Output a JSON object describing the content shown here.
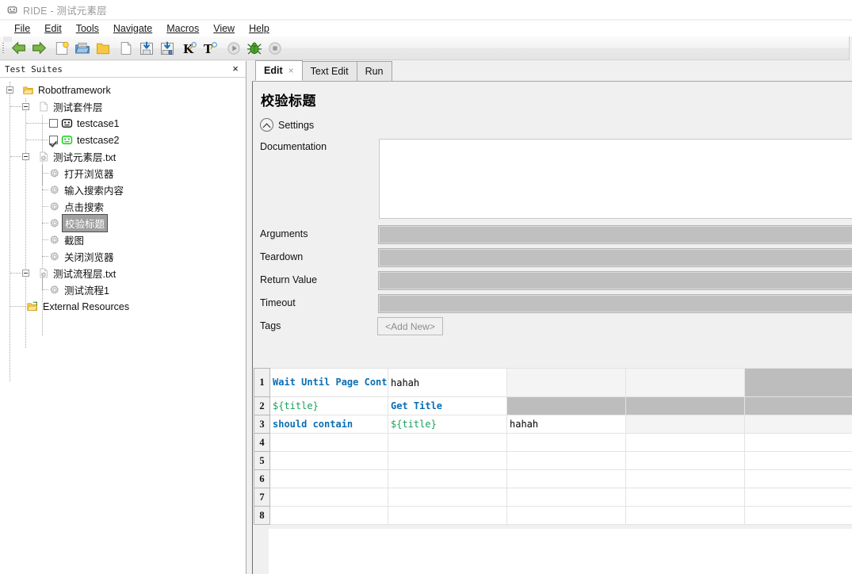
{
  "window": {
    "title": "RIDE - 测试元素层",
    "icon": "robot-icon"
  },
  "menubar": {
    "items": [
      {
        "label": "File",
        "mnemonic": "F"
      },
      {
        "label": "Edit",
        "mnemonic": "E"
      },
      {
        "label": "Tools",
        "mnemonic": "T"
      },
      {
        "label": "Navigate",
        "mnemonic": "N"
      },
      {
        "label": "Macros",
        "mnemonic": "M"
      },
      {
        "label": "View",
        "mnemonic": "V"
      },
      {
        "label": "Help",
        "mnemonic": "H"
      }
    ]
  },
  "toolbar": {
    "buttons": [
      {
        "name": "back-icon",
        "tip": "Back"
      },
      {
        "name": "forward-icon",
        "tip": "Forward"
      },
      {
        "name": "new-project-icon",
        "tip": "New Project"
      },
      {
        "name": "open-project-icon",
        "tip": "Open Project"
      },
      {
        "name": "open-directory-icon",
        "tip": "Open Directory"
      },
      {
        "name": "new-file-icon",
        "tip": "New File"
      },
      {
        "name": "save-icon",
        "tip": "Save"
      },
      {
        "name": "save-all-icon",
        "tip": "Save All"
      },
      {
        "name": "search-keyword-icon",
        "tip": "Search Keywords"
      },
      {
        "name": "search-tests-icon",
        "tip": "Search Tests"
      },
      {
        "name": "run-icon",
        "tip": "Run"
      },
      {
        "name": "debug-icon",
        "tip": "Debug"
      },
      {
        "name": "stop-icon",
        "tip": "Stop"
      }
    ]
  },
  "sidebar": {
    "title": "Test Suites",
    "close_label": "×",
    "tree": [
      {
        "label": "Robotframework",
        "icon": "folder-icon",
        "depth": 0,
        "expander": true,
        "checkbox": null
      },
      {
        "label": "测试套件层",
        "icon": "file-icon",
        "depth": 1,
        "expander": true,
        "checkbox": null
      },
      {
        "label": "testcase1",
        "icon": "robot-black-icon",
        "depth": 2,
        "expander": false,
        "checkbox": "unchecked"
      },
      {
        "label": "testcase2",
        "icon": "robot-green-icon",
        "depth": 2,
        "expander": false,
        "checkbox": "checked"
      },
      {
        "label": "测试元素层.txt",
        "icon": "resource-file-icon",
        "depth": 1,
        "expander": true,
        "checkbox": null
      },
      {
        "label": "打开浏览器",
        "icon": "gear-icon",
        "depth": 2,
        "expander": false,
        "checkbox": null
      },
      {
        "label": "输入搜索内容",
        "icon": "gear-icon",
        "depth": 2,
        "expander": false,
        "checkbox": null
      },
      {
        "label": "点击搜索",
        "icon": "gear-icon",
        "depth": 2,
        "expander": false,
        "checkbox": null
      },
      {
        "label": "校验标题",
        "icon": "gear-icon",
        "depth": 2,
        "expander": false,
        "checkbox": null,
        "selected": true
      },
      {
        "label": "截图",
        "icon": "gear-icon",
        "depth": 2,
        "expander": false,
        "checkbox": null
      },
      {
        "label": "关闭浏览器",
        "icon": "gear-icon",
        "depth": 2,
        "expander": false,
        "checkbox": null
      },
      {
        "label": "测试流程层.txt",
        "icon": "resource-file-icon",
        "depth": 1,
        "expander": true,
        "checkbox": null
      },
      {
        "label": "测试流程1",
        "icon": "gear-icon",
        "depth": 2,
        "expander": false,
        "checkbox": null
      },
      {
        "label": "External Resources",
        "icon": "ext-resources-icon",
        "depth": 1,
        "expander": false,
        "checkbox": null
      }
    ]
  },
  "editor": {
    "tabs": [
      {
        "label": "Edit",
        "active": true,
        "closable": true,
        "close_label": "×"
      },
      {
        "label": "Text Edit",
        "active": false,
        "closable": false
      },
      {
        "label": "Run",
        "active": false,
        "closable": false
      }
    ],
    "keyword_title": "校验标题",
    "settings_label": "Settings",
    "fields": [
      {
        "label": "Documentation",
        "value": "",
        "kind": "textarea"
      },
      {
        "label": "Arguments",
        "value": "",
        "kind": "text"
      },
      {
        "label": "Teardown",
        "value": "",
        "kind": "text"
      },
      {
        "label": "Return Value",
        "value": "",
        "kind": "text"
      },
      {
        "label": "Timeout",
        "value": "",
        "kind": "text"
      },
      {
        "label": "Tags",
        "value": "<Add New>",
        "kind": "button"
      }
    ],
    "grid": {
      "row_numbers": [
        "1",
        "2",
        "3",
        "4",
        "5",
        "6",
        "7",
        "8"
      ],
      "rows": [
        {
          "num": "1",
          "cells": [
            {
              "text": "Wait Until Page Contains",
              "style": "kw",
              "bg": "white"
            },
            {
              "text": "hahah",
              "style": "txt",
              "bg": "white"
            },
            {
              "text": "",
              "style": "none",
              "bg": "lite"
            },
            {
              "text": "",
              "style": "none",
              "bg": "lite"
            },
            {
              "text": "",
              "style": "none",
              "bg": "gray"
            }
          ]
        },
        {
          "num": "2",
          "cells": [
            {
              "text": "${title}",
              "style": "var",
              "bg": "white"
            },
            {
              "text": "Get Title",
              "style": "kw",
              "bg": "white"
            },
            {
              "text": "",
              "style": "none",
              "bg": "gray"
            },
            {
              "text": "",
              "style": "none",
              "bg": "gray"
            },
            {
              "text": "",
              "style": "none",
              "bg": "gray"
            }
          ]
        },
        {
          "num": "3",
          "cells": [
            {
              "text": "should contain",
              "style": "kw",
              "bg": "white"
            },
            {
              "text": "${title}",
              "style": "var",
              "bg": "white"
            },
            {
              "text": "hahah",
              "style": "txt",
              "bg": "white"
            },
            {
              "text": "",
              "style": "none",
              "bg": "lite"
            },
            {
              "text": "",
              "style": "none",
              "bg": "lite"
            }
          ]
        },
        {
          "num": "4",
          "cells": [
            {
              "text": "",
              "style": "none",
              "bg": "white"
            },
            {
              "text": "",
              "style": "none",
              "bg": "white"
            },
            {
              "text": "",
              "style": "none",
              "bg": "white"
            },
            {
              "text": "",
              "style": "none",
              "bg": "white"
            },
            {
              "text": "",
              "style": "none",
              "bg": "white"
            }
          ]
        },
        {
          "num": "5",
          "cells": [
            {
              "text": "",
              "style": "none",
              "bg": "white"
            },
            {
              "text": "",
              "style": "none",
              "bg": "white"
            },
            {
              "text": "",
              "style": "none",
              "bg": "white"
            },
            {
              "text": "",
              "style": "none",
              "bg": "white"
            },
            {
              "text": "",
              "style": "none",
              "bg": "white"
            }
          ]
        },
        {
          "num": "6",
          "cells": [
            {
              "text": "",
              "style": "none",
              "bg": "white"
            },
            {
              "text": "",
              "style": "none",
              "bg": "white"
            },
            {
              "text": "",
              "style": "none",
              "bg": "white"
            },
            {
              "text": "",
              "style": "none",
              "bg": "white"
            },
            {
              "text": "",
              "style": "none",
              "bg": "white"
            }
          ]
        },
        {
          "num": "7",
          "cells": [
            {
              "text": "",
              "style": "none",
              "bg": "white"
            },
            {
              "text": "",
              "style": "none",
              "bg": "white"
            },
            {
              "text": "",
              "style": "none",
              "bg": "white"
            },
            {
              "text": "",
              "style": "none",
              "bg": "white"
            },
            {
              "text": "",
              "style": "none",
              "bg": "white"
            }
          ]
        },
        {
          "num": "8",
          "cells": [
            {
              "text": "",
              "style": "none",
              "bg": "white"
            },
            {
              "text": "",
              "style": "none",
              "bg": "white"
            },
            {
              "text": "",
              "style": "none",
              "bg": "white"
            },
            {
              "text": "",
              "style": "none",
              "bg": "white"
            },
            {
              "text": "",
              "style": "none",
              "bg": "white"
            }
          ]
        }
      ]
    }
  },
  "colors": {
    "keyword_blue": "#0a6fb5",
    "variable_green": "#19a05a",
    "selection_gray": "#a0a0a0",
    "cell_gray": "#bdbdbd",
    "panel_bg": "#f0f0f0"
  }
}
